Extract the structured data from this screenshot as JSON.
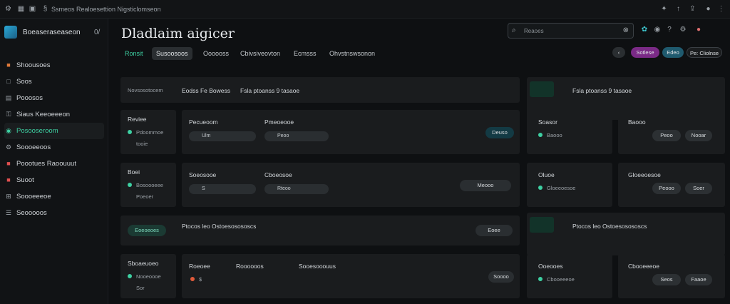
{
  "topbar": {
    "path": "Ssmeos Realoesettion Nigsticlomseon"
  },
  "sidebar": {
    "brand": "Boeaseraseaseon",
    "version": "0/",
    "items": [
      {
        "label": "Shoousoes",
        "icon": "home-icon"
      },
      {
        "label": "Soos",
        "icon": "box-icon"
      },
      {
        "label": "Pooosos",
        "icon": "document-icon"
      },
      {
        "label": "Siaus Keeoeeeon",
        "icon": "key-icon"
      },
      {
        "label": "Posooseroom",
        "icon": "lock-icon",
        "active": true
      },
      {
        "label": "Soooeeoos",
        "icon": "gear-icon"
      },
      {
        "label": "Poootues Raoouuut",
        "icon": "report-icon"
      },
      {
        "label": "Suoot",
        "icon": "bolt-icon"
      },
      {
        "label": "Soooeeeoe",
        "icon": "grid-icon"
      },
      {
        "label": "Seooooos",
        "icon": "layers-icon"
      }
    ]
  },
  "header": {
    "title": "Dladlaim aigicer",
    "search_placeholder": "Reaoes",
    "tabs": [
      "Ronsit",
      "Susoosoos",
      "Oooooss",
      "Cbivsiveovton",
      "Ecmsss",
      "Ohvstnswsonon"
    ],
    "seg": [
      "Sotlese",
      "Edeo",
      "Pe: Cliolnse"
    ]
  },
  "banners": [
    {
      "a": "Novsosotocem",
      "b": "Eodss Fe Bowess",
      "c": "Fsla ptoanss 9 tasaoe"
    },
    {
      "a": "Eoeoeoes",
      "b": "Ptocos leo Ostoesosososcs",
      "c": "Eoee"
    }
  ],
  "rows": [
    {
      "label": "Reviee",
      "l1": "Pdoommoe",
      "l2": "tooie",
      "c1": "Pecueoom",
      "c2": "Pmeoeooe",
      "chip1": "Ulm",
      "chip2": "Peoo",
      "btn": "Deuso",
      "mid1": "Soasor",
      "mid2": "Baooo",
      "btn2": "Peoo",
      "btn3": "Nooar"
    },
    {
      "label": "Boei",
      "l1": "Bosoooeee",
      "l2": "Poeoer",
      "c1": "Soeosooe",
      "c2": "Cboeosoe",
      "chip1": "S",
      "chip2": "Rteoo",
      "btn": "Meooo",
      "mid1": "Oluoe",
      "mid2": "Gloeeoesoe",
      "btn2": "Peooo",
      "btn3": "Soer"
    },
    {
      "label": "Sboaeuoeo",
      "l1": "Nooeoooe",
      "l2": "Sor",
      "c1": "Roeoee",
      "c2": "Roooooos",
      "chip1": "$",
      "chip2": "Sooesooouus",
      "btn": "Soooo",
      "mid1": "Ooeooes",
      "mid2": "Cbooeeeoe",
      "btn2": "Seos",
      "btn3": "Faaoe"
    }
  ],
  "colors": {
    "accent": "#3ed0a2",
    "pink": "#c03aa0",
    "teal": "#1f6f86",
    "bg": "#0e1012",
    "card": "#1a1c1e"
  }
}
